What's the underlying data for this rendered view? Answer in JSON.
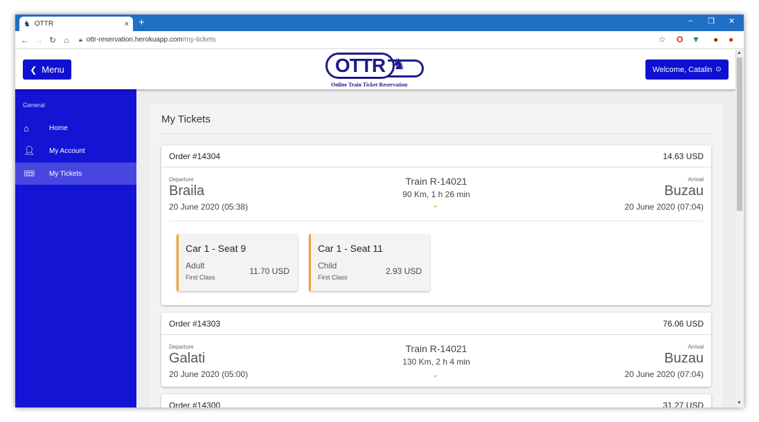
{
  "browser": {
    "tab_title": "OTTR",
    "tab_close": "×",
    "new_tab": "+",
    "url_host": "ottr-reservation.herokuapp.com",
    "url_path": "/my-tickets",
    "window_controls": [
      "–",
      "❐",
      "✕"
    ]
  },
  "header": {
    "menu_label": "Menu",
    "logo_text": "OTTR",
    "logo_subtitle": "Online Train Ticket Reservation",
    "welcome_label": "Welcome, Catalin"
  },
  "sidebar": {
    "section": "General",
    "items": [
      {
        "label": "Home",
        "icon": "home-icon"
      },
      {
        "label": "My Account",
        "icon": "user-icon"
      },
      {
        "label": "My Tickets",
        "icon": "ticket-icon",
        "active": true
      }
    ]
  },
  "main": {
    "title": "My Tickets",
    "departure_label": "Departure",
    "arrival_label": "Arrival",
    "orders": [
      {
        "id": "Order #14304",
        "total": "14.63 USD",
        "departure_city": "Braila",
        "departure_time": "20 June 2020 (05:38)",
        "train": "Train R-14021",
        "distance": "90 Km, 1 h 26 min",
        "arrival_city": "Buzau",
        "arrival_time": "20 June 2020 (07:04)",
        "expanded": true,
        "seats": [
          {
            "name": "Car 1 - Seat 9",
            "type": "Adult",
            "class": "First Class",
            "price": "11.70 USD"
          },
          {
            "name": "Car 1 - Seat 11",
            "type": "Child",
            "class": "First Class",
            "price": "2.93 USD"
          }
        ]
      },
      {
        "id": "Order #14303",
        "total": "76.06 USD",
        "departure_city": "Galati",
        "departure_time": "20 June 2020 (05:00)",
        "train": "Train R-14021",
        "distance": "130 Km, 2 h 4 min",
        "arrival_city": "Buzau",
        "arrival_time": "20 June 2020 (07:04)",
        "expanded": false
      },
      {
        "id": "Order #14300",
        "total": "31.27 USD"
      }
    ]
  },
  "colors": {
    "primary": "#1414d4",
    "sidebar_active": "#4747e0",
    "accent": "#f4a428",
    "browser_bar": "#1f6fc5"
  }
}
